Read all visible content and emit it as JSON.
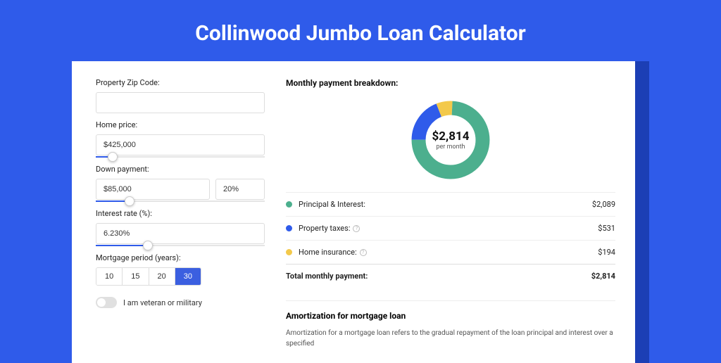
{
  "title": "Collinwood Jumbo Loan Calculator",
  "form": {
    "zip_label": "Property Zip Code:",
    "zip_value": "",
    "home_price_label": "Home price:",
    "home_price_value": "$425,000",
    "home_price_slider_pct": 10,
    "down_payment_label": "Down payment:",
    "down_payment_value": "$85,000",
    "down_payment_pct": "20%",
    "down_payment_slider_pct": 20,
    "interest_label": "Interest rate (%):",
    "interest_value": "6.230%",
    "interest_slider_pct": 31,
    "period_label": "Mortgage period (years):",
    "periods": [
      "10",
      "15",
      "20",
      "30"
    ],
    "period_active": "30",
    "veteran_label": "I am veteran or military"
  },
  "breakdown": {
    "section_title": "Monthly payment breakdown:",
    "center_amount": "$2,814",
    "center_sub": "per month",
    "rows": [
      {
        "label": "Principal & Interest:",
        "value": "$2,089",
        "amount": 2089,
        "color": "#4CAF8E",
        "info": false
      },
      {
        "label": "Property taxes:",
        "value": "$531",
        "amount": 531,
        "color": "#2F5BEA",
        "info": true
      },
      {
        "label": "Home insurance:",
        "value": "$194",
        "amount": 194,
        "color": "#F3C94B",
        "info": true
      }
    ],
    "total_label": "Total monthly payment:",
    "total_value": "$2,814"
  },
  "chart_data": {
    "type": "pie",
    "title": "Monthly payment breakdown",
    "categories": [
      "Principal & Interest",
      "Property taxes",
      "Home insurance"
    ],
    "values": [
      2089,
      531,
      194
    ],
    "colors": [
      "#4CAF8E",
      "#2F5BEA",
      "#F3C94B"
    ],
    "total": 2814,
    "center_label": "$2,814 per month"
  },
  "amortization": {
    "title": "Amortization for mortgage loan",
    "text": "Amortization for a mortgage loan refers to the gradual repayment of the loan principal and interest over a specified"
  }
}
